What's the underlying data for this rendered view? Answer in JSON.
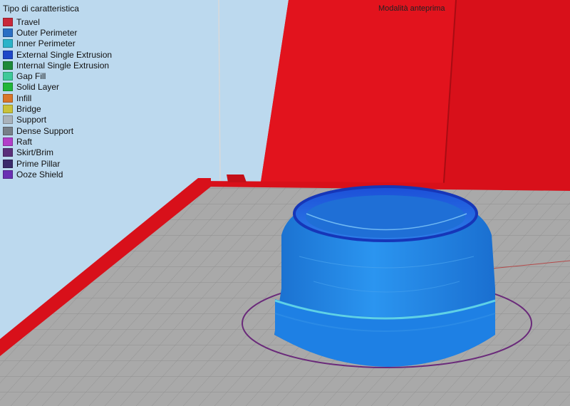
{
  "legend": {
    "title": "Tipo di caratteristica",
    "items": [
      {
        "label": "Travel",
        "color": "#c8283a"
      },
      {
        "label": "Outer Perimeter",
        "color": "#2a6fc4"
      },
      {
        "label": "Inner Perimeter",
        "color": "#2bb3c9"
      },
      {
        "label": "External Single Extrusion",
        "color": "#1f48c8"
      },
      {
        "label": "Internal Single Extrusion",
        "color": "#1e8a3a"
      },
      {
        "label": "Gap Fill",
        "color": "#3ec99a"
      },
      {
        "label": "Solid Layer",
        "color": "#22b63a"
      },
      {
        "label": "Infill",
        "color": "#d9762a"
      },
      {
        "label": "Bridge",
        "color": "#c9c23a"
      },
      {
        "label": "Support",
        "color": "#a9b2bb"
      },
      {
        "label": "Dense Support",
        "color": "#777f88"
      },
      {
        "label": "Raft",
        "color": "#b23ec9"
      },
      {
        "label": "Skirt/Brim",
        "color": "#5a2f7a"
      },
      {
        "label": "Prime Pillar",
        "color": "#3a2a6b"
      },
      {
        "label": "Ooze Shield",
        "color": "#6a2fb3"
      }
    ]
  },
  "mode_label": "Modalità anteprima",
  "colors": {
    "background": "#bcd9ee",
    "bed": "#a9a9a9",
    "bed_grid": "#8e8e8e",
    "frame": "#d8101a",
    "part": "#1f86e6",
    "skirt": "#6a2a7a"
  }
}
